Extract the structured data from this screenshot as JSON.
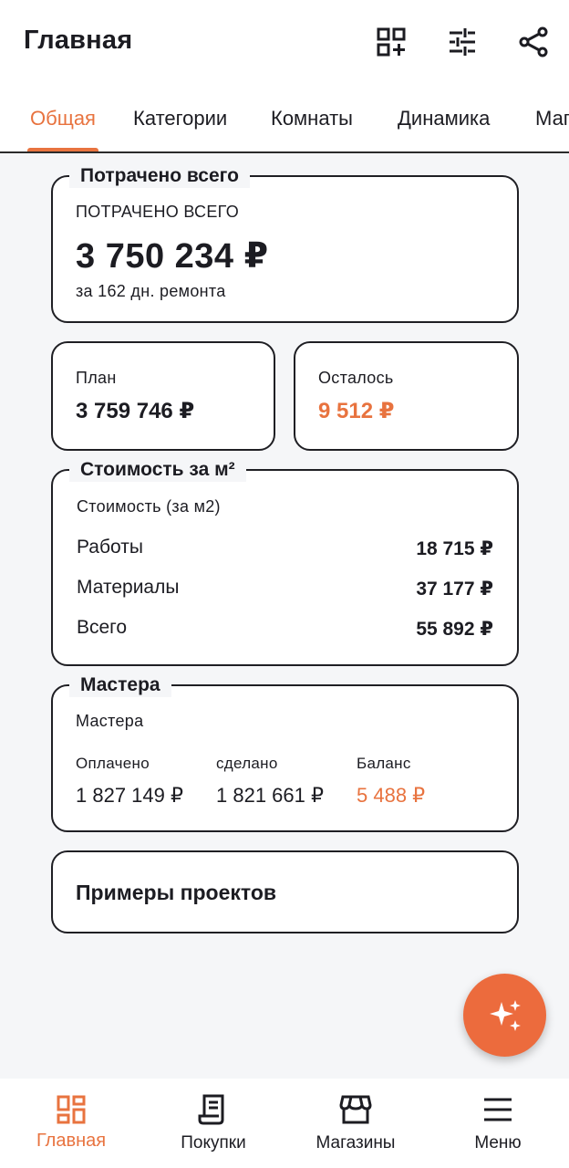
{
  "header": {
    "title": "Главная",
    "icons": [
      "qr-add-icon",
      "sliders-icon",
      "share-icon"
    ]
  },
  "tabs": [
    {
      "label": "Общая",
      "active": true
    },
    {
      "label": "Категории"
    },
    {
      "label": "Комнаты"
    },
    {
      "label": "Динамика"
    },
    {
      "label": "Магазины"
    }
  ],
  "spent": {
    "legend": "Потрачено всего",
    "caption": "ПОТРАЧЕНО ВСЕГО",
    "amount": "3 750 234 ₽",
    "subtitle": "за 162 дн. ремонта"
  },
  "plan": {
    "label": "План",
    "value": "3 759 746 ₽"
  },
  "remaining": {
    "label": "Осталось",
    "value": "9 512 ₽"
  },
  "cost_per_m2": {
    "legend": "Стоимость за м²",
    "caption": "Стоимость (за м2)",
    "rows": [
      {
        "label": "Работы",
        "value": "18 715 ₽"
      },
      {
        "label": "Материалы",
        "value": "37 177 ₽"
      },
      {
        "label": "Всего",
        "value": "55 892 ₽"
      }
    ]
  },
  "masters": {
    "legend": "Мастера",
    "caption": "Мастера",
    "cols": [
      {
        "label": "Оплачено",
        "value": "1 827 149 ₽"
      },
      {
        "label": "сделано",
        "value": "1 821 661 ₽"
      },
      {
        "label": "Баланс",
        "value": "5 488 ₽"
      }
    ]
  },
  "examples": {
    "label": "Примеры проектов"
  },
  "fab": {
    "icon": "sparkles-icon"
  },
  "bottom_nav": [
    {
      "label": "Главная",
      "icon": "dashboard-icon",
      "active": true
    },
    {
      "label": "Покупки",
      "icon": "receipt-icon"
    },
    {
      "label": "Магазины",
      "icon": "store-icon"
    },
    {
      "label": "Меню",
      "icon": "menu-icon"
    }
  ],
  "colors": {
    "accent": "#e8733f",
    "fab": "#ec6b3d",
    "text": "#1c1c22"
  }
}
